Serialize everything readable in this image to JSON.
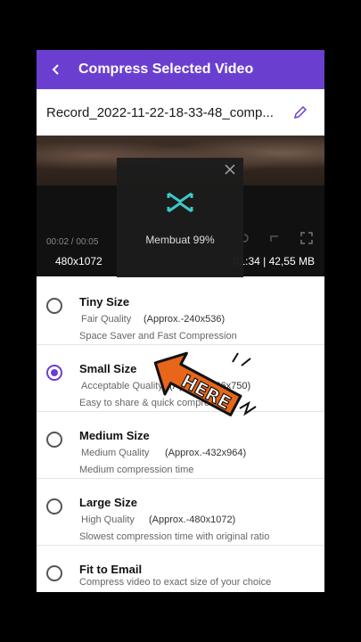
{
  "header": {
    "title": "Compress Selected Video"
  },
  "file": {
    "name": "Record_2022-11-22-18-33-48_comp..."
  },
  "video": {
    "time": "00:02 / 00:05",
    "resolution": "480x1072",
    "info": "01:34 | 42,55 MB"
  },
  "progress": {
    "label": "Membuat 99%",
    "percent": 99
  },
  "options": [
    {
      "name": "Tiny Size",
      "quality": "Fair Quality",
      "approx": "(Approx.-240x536)",
      "description": "Space Saver and Fast Compression",
      "selected": false
    },
    {
      "name": "Small Size",
      "quality": "Acceptable Quality",
      "approx": "(Approx.-336x750)",
      "description": "Easy to share & quick compression.",
      "selected": true
    },
    {
      "name": "Medium Size",
      "quality": "Medium Quality",
      "approx": "(Approx.-432x964)",
      "description": "Medium compression time",
      "selected": false
    },
    {
      "name": "Large Size",
      "quality": "High Quality",
      "approx": "(Approx.-480x1072)",
      "description": "Slowest compression time with original ratio",
      "selected": false
    },
    {
      "name": "Fit to Email",
      "quality": "",
      "approx": "",
      "description": "Compress video to exact size of your choice",
      "selected": false
    }
  ],
  "sticker": {
    "text": "HERE"
  },
  "colors": {
    "accent": "#6a3fd0",
    "sticker_fill": "#e8661a"
  },
  "icons": {
    "back": "back-arrow-icon",
    "edit": "pencil-icon",
    "close": "close-icon",
    "logo": "capcut-logo-icon"
  }
}
